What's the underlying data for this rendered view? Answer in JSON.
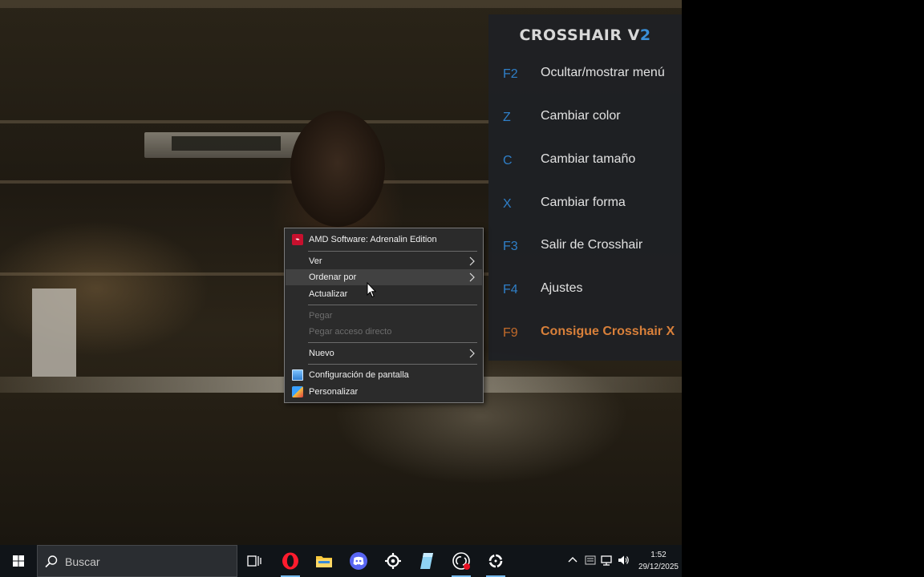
{
  "crosshair_panel": {
    "title_main": "CROSSHAIR V",
    "title_accent": "2",
    "items": [
      {
        "key": "F2",
        "label": "Ocultar/mostrar menú"
      },
      {
        "key": "Z",
        "label": "Cambiar color"
      },
      {
        "key": "C",
        "label": "Cambiar tamaño"
      },
      {
        "key": "X",
        "label": "Cambiar forma"
      },
      {
        "key": "F3",
        "label": "Salir de Crosshair"
      },
      {
        "key": "F4",
        "label": "Ajustes"
      },
      {
        "key": "F9",
        "label": "Consigue Crosshair X"
      }
    ],
    "key_color": "#2f7fc8",
    "promo_color": "#d9803a"
  },
  "context_menu": {
    "items": [
      {
        "label": "AMD Software: Adrenalin Edition",
        "icon": "amd-icon"
      },
      {
        "label": "Ver",
        "submenu": true
      },
      {
        "label": "Ordenar por",
        "submenu": true,
        "hover": true
      },
      {
        "label": "Actualizar"
      },
      {
        "label": "Pegar",
        "disabled": true
      },
      {
        "label": "Pegar acceso directo",
        "disabled": true
      },
      {
        "label": "Nuevo",
        "submenu": true
      },
      {
        "label": "Configuración de pantalla",
        "icon": "display-settings-icon"
      },
      {
        "label": "Personalizar",
        "icon": "personalize-icon"
      }
    ]
  },
  "taskbar": {
    "search_placeholder": "Buscar",
    "pinned": [
      "task-view-icon",
      "opera-icon",
      "file-explorer-icon",
      "discord-icon",
      "steam-icon",
      "notepad-icon",
      "obs-icon",
      "crosshair-icon"
    ],
    "clock_time": "1:52",
    "clock_date": "29/12/2025"
  }
}
